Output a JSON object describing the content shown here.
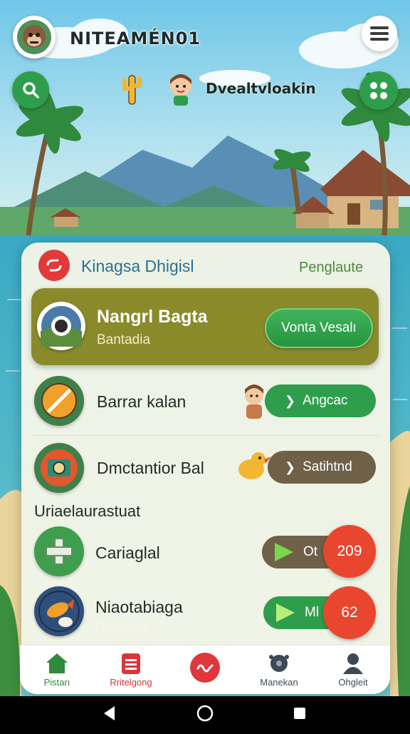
{
  "header": {
    "username": "NITEAMÉN01",
    "greeting": "Dvealtvloakin"
  },
  "panel": {
    "title": "Kinagsa Dhigisl",
    "link": "Penglaute"
  },
  "featured": {
    "title": "Nangrl Bagta",
    "subtitle": "Bantadia",
    "button": "Vonta Vesalı"
  },
  "items": [
    {
      "label": "Barrar kalan",
      "action": "Angcac"
    },
    {
      "label": "Dmctantior Bal",
      "action": "Satihtnd"
    }
  ],
  "section_title": "Uriaelaurastuat",
  "items2": [
    {
      "label": "Cariaglal",
      "action": "Ot",
      "badge": "209"
    },
    {
      "label": "Niaotabiaga",
      "sublabel": "Gantndia",
      "action": "Ml",
      "badge": "62"
    }
  ],
  "nav": [
    {
      "label": "Pistarı"
    },
    {
      "label": "Rritelgong"
    },
    {
      "label": ""
    },
    {
      "label": "Manekan"
    },
    {
      "label": "Ohgleit"
    }
  ],
  "colors": {
    "accent_green": "#2f9e4c",
    "olive": "#8b8a2b",
    "badge_red": "#e8462e",
    "title_blue": "#2e6e8e"
  }
}
